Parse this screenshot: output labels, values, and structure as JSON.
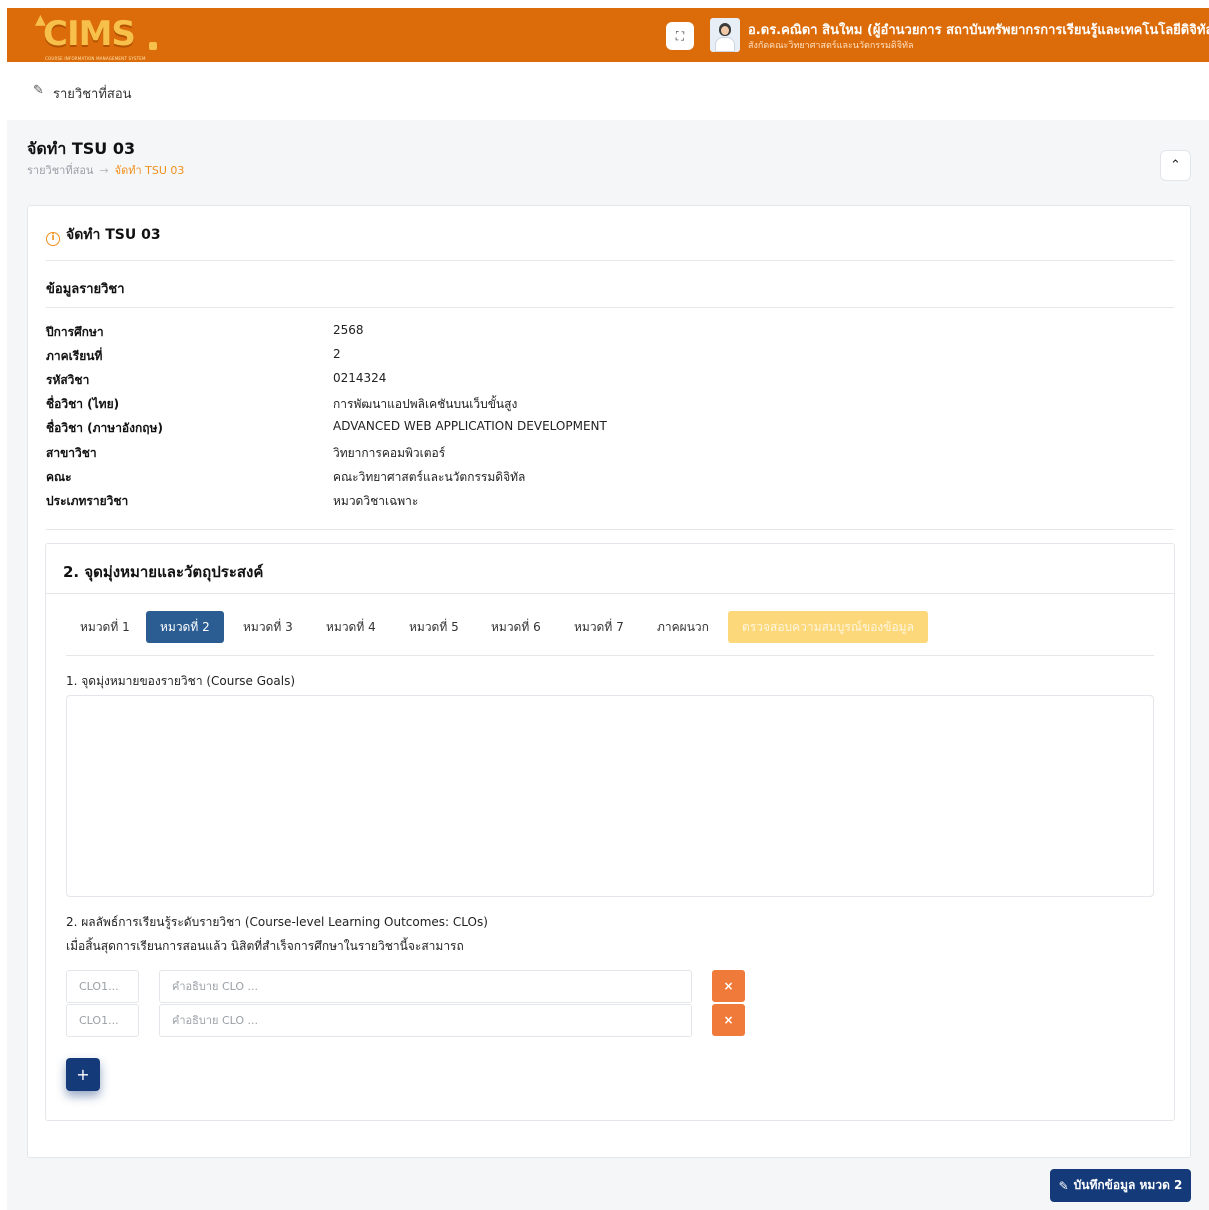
{
  "header": {
    "logo_text": "CIMS",
    "logo_subtitle": "COURSE INFORMATION MANAGEMENT SYSTEM",
    "user_name": "อ.ดร.คณิดา สินใหม (ผู้อำนวยการ สถาบันทรัพยากรการเรียนรู้และเทคโนโลยีดิจิทัล)",
    "user_org": "สังกัดคณะวิทยาศาสตร์และนวัตกรรมดิจิทัล",
    "colors": {
      "topbar": "#dc6b09",
      "logo": "#f7c04a"
    },
    "icons": {
      "expand": "fullscreen-icon",
      "dropdown": "chevron-down-icon"
    }
  },
  "nav": {
    "label": "รายวิชาที่สอน",
    "icon": "edit-icon"
  },
  "page": {
    "title": "จัดทำ TSU 03",
    "breadcrumb": [
      "รายวิชาที่สอน",
      "จัดทำ TSU 03"
    ]
  },
  "card": {
    "title": "จัดทำ TSU 03",
    "section_title": "ข้อมูลรายวิชา",
    "info": [
      {
        "label": "ปีการศึกษา",
        "value": "2568"
      },
      {
        "label": "ภาคเรียนที่",
        "value": "2"
      },
      {
        "label": "รหัสวิชา",
        "value": "0214324"
      },
      {
        "label": "ชื่อวิชา (ไทย)",
        "value": "การพัฒนาแอปพลิเคชันบนเว็บขั้นสูง"
      },
      {
        "label": "ชื่อวิชา (ภาษาอังกฤษ)",
        "value": "ADVANCED WEB APPLICATION DEVELOPMENT"
      },
      {
        "label": "สาขาวิชา",
        "value": "วิทยาการคอมพิวเตอร์"
      },
      {
        "label": "คณะ",
        "value": "คณะวิทยาศาสตร์และนวัตกรรมดิจิทัล"
      },
      {
        "label": "ประเภทรายวิชา",
        "value": "หมวดวิชาเฉพาะ"
      }
    ]
  },
  "section2": {
    "title": "2. จุดมุ่งหมายและวัตถุประสงค์",
    "tabs": [
      {
        "label": "หมวดที่ 1",
        "state": "normal"
      },
      {
        "label": "หมวดที่ 2",
        "state": "active"
      },
      {
        "label": "หมวดที่ 3",
        "state": "normal"
      },
      {
        "label": "หมวดที่ 4",
        "state": "normal"
      },
      {
        "label": "หมวดที่ 5",
        "state": "normal"
      },
      {
        "label": "หมวดที่ 6",
        "state": "normal"
      },
      {
        "label": "หมวดที่ 7",
        "state": "normal"
      },
      {
        "label": "ภาคผนวก",
        "state": "normal"
      },
      {
        "label": "ตรวจสอบความสมบูรณ์ของข้อมูล",
        "state": "check"
      }
    ],
    "goals_label": "1. จุดมุ่งหมายของรายวิชา (Course Goals)",
    "goals_value": "",
    "clo_label": "2. ผลลัพธ์การเรียนรู้ระดับรายวิชา (Course-level Learning Outcomes: CLOs)",
    "clo_sublabel": "เมื่อสิ้นสุดการเรียนการสอนแล้ว นิสิตที่สำเร็จการศึกษาในรายวิชานี้จะสามารถ",
    "clos": [
      {
        "code_placeholder": "CLO1...",
        "desc_placeholder": "คำอธิบาย CLO ...",
        "code_value": "",
        "desc_value": ""
      },
      {
        "code_placeholder": "CLO1...",
        "desc_placeholder": "คำอธิบาย CLO ...",
        "code_value": "",
        "desc_value": ""
      }
    ],
    "delete_label": "×",
    "add_label": "+"
  },
  "save_button": {
    "label": "บันทึกข้อมูล หมวด 2",
    "icon": "edit-icon"
  }
}
